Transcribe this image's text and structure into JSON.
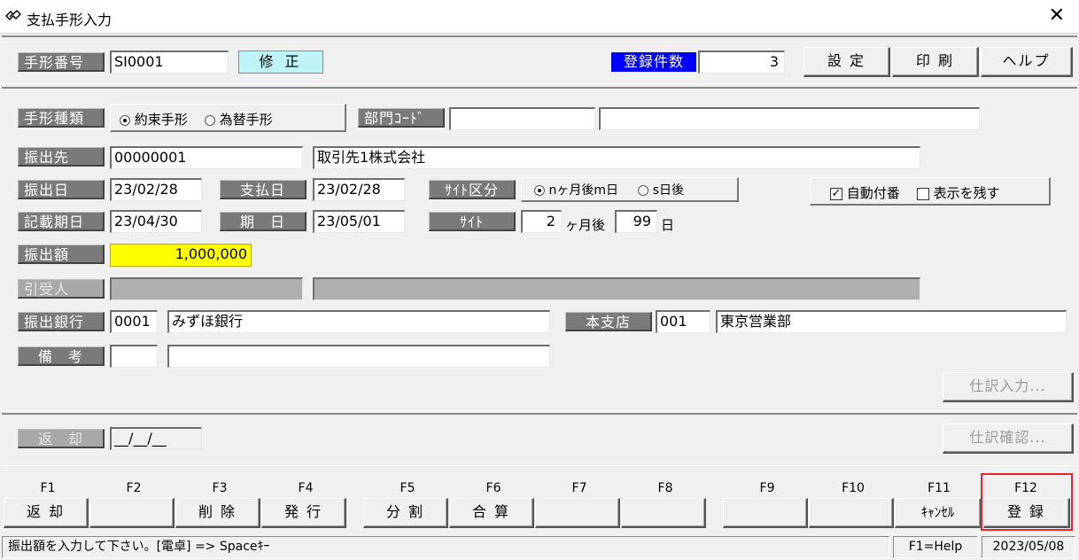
{
  "window": {
    "title": "支払手形入力",
    "close_glyph": "✕"
  },
  "header": {
    "bill_no_label": "手形番号",
    "bill_no_value": "SI0001",
    "mode_badge": "修 正",
    "reg_count_label": "登録件数",
    "reg_count_value": "3",
    "settings_btn": "設 定",
    "print_btn": "印 刷",
    "help_btn": "ヘルプ"
  },
  "form": {
    "bill_type_label": "手形種類",
    "bill_type_options": [
      "約束手形",
      "為替手形"
    ],
    "bill_type_selected": "約束手形",
    "dept_code_label": "部門ｺｰﾄﾞ",
    "dept_code_value": "",
    "dept_name_value": "",
    "payee_label": "振出先",
    "payee_code": "00000001",
    "payee_name": "取引先1株式会社",
    "issue_date_label": "振出日",
    "issue_date": "23/02/28",
    "pay_date_label": "支払日",
    "pay_date": "23/02/28",
    "site_type_label": "ｻｲﾄ区分",
    "site_type_options": [
      "nヶ月後m日",
      "s日後"
    ],
    "site_type_selected": "nヶ月後m日",
    "auto_number_label": "自動付番",
    "auto_number_checked": true,
    "keep_display_label": "表示を残す",
    "keep_display_checked": false,
    "entry_date_label": "記載期日",
    "entry_date": "23/04/30",
    "due_date_label": "期　日",
    "due_date": "23/05/01",
    "site_label": "ｻｲﾄ",
    "site_months": "2",
    "site_months_unit": "ヶ月後",
    "site_days": "99",
    "site_days_unit": "日",
    "amount_label": "振出額",
    "amount_value": "1,000,000",
    "acceptor_label": "引受人",
    "bank_label": "振出銀行",
    "bank_code": "0001",
    "bank_name": "みずほ銀行",
    "branch_label": "本支店",
    "branch_code": "001",
    "branch_name": "東京営業部",
    "memo_label": "備　考",
    "memo_code": "",
    "memo_text": "",
    "journal_entry_btn": "仕訳入力...",
    "return_label": "返　却",
    "return_value": "__/__/__",
    "journal_confirm_btn": "仕訳確認..."
  },
  "fkeys": [
    {
      "key": "F1",
      "label": "返 却"
    },
    {
      "key": "F2",
      "label": ""
    },
    {
      "key": "F3",
      "label": "削 除"
    },
    {
      "key": "F4",
      "label": "発 行"
    },
    {
      "key": "F5",
      "label": "分 割"
    },
    {
      "key": "F6",
      "label": "合 算"
    },
    {
      "key": "F7",
      "label": ""
    },
    {
      "key": "F8",
      "label": ""
    },
    {
      "key": "F9",
      "label": ""
    },
    {
      "key": "F10",
      "label": ""
    },
    {
      "key": "F11",
      "label": "ｷｬﾝｾﾙ"
    },
    {
      "key": "F12",
      "label": "登 録"
    }
  ],
  "status": {
    "message": "振出額を入力して下さい。[電卓] => Spaceｷｰ",
    "help": "F1=Help",
    "date": "2023/05/08"
  },
  "colors": {
    "highlight_box": "#e8262b",
    "amount_bg": "#ffff00",
    "mode_bg": "#bff4f6",
    "count_label_bg": "#0000ff"
  }
}
